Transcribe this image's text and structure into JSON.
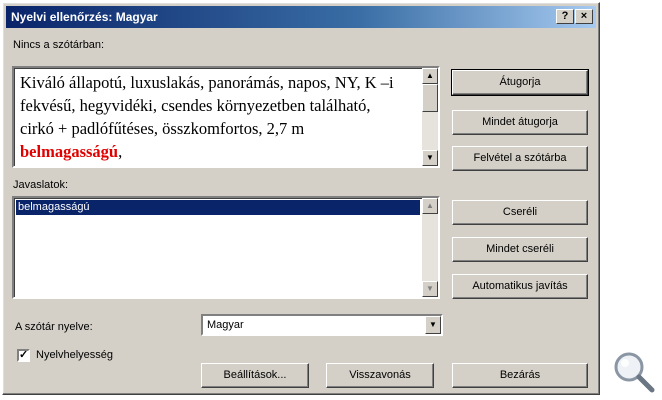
{
  "title": "Nyelvi ellenőrzés: Magyar",
  "titlebar_buttons": {
    "help": "?",
    "close": "×"
  },
  "not_in_dictionary": {
    "label": "Nincs a szótárban:",
    "text_before": "Kiváló állapotú, luxuslakás, panorámás, napos, NY, K –i fekvésű, hegyvidéki, csendes környezetben található, cirkó + padlófűtéses, összkomfortos, 2,7 m ",
    "error_word": "belmagasságú",
    "text_after": ","
  },
  "buttons_top": {
    "ignore": "Átugorja",
    "ignore_all": "Mindet átugorja",
    "add": "Felvétel a szótárba"
  },
  "suggestions": {
    "label": "Javaslatok:",
    "items": [
      "belmagasságú"
    ]
  },
  "buttons_mid": {
    "change": "Cseréli",
    "change_all": "Mindet cseréli",
    "autocorrect": "Automatikus javítás"
  },
  "dictionary_language": {
    "label": "A szótár nyelve:",
    "value": "Magyar"
  },
  "grammar_check": {
    "label": "Nyelvhelyesség",
    "checked": true
  },
  "buttons_bottom": {
    "options": "Beállítások...",
    "undo": "Visszavonás",
    "close": "Bezárás"
  },
  "icons": {
    "zoom": "magnifier-icon",
    "scroll_up": "scroll-up-arrow-icon",
    "scroll_down": "scroll-down-arrow-icon",
    "dropdown": "dropdown-arrow-icon"
  }
}
